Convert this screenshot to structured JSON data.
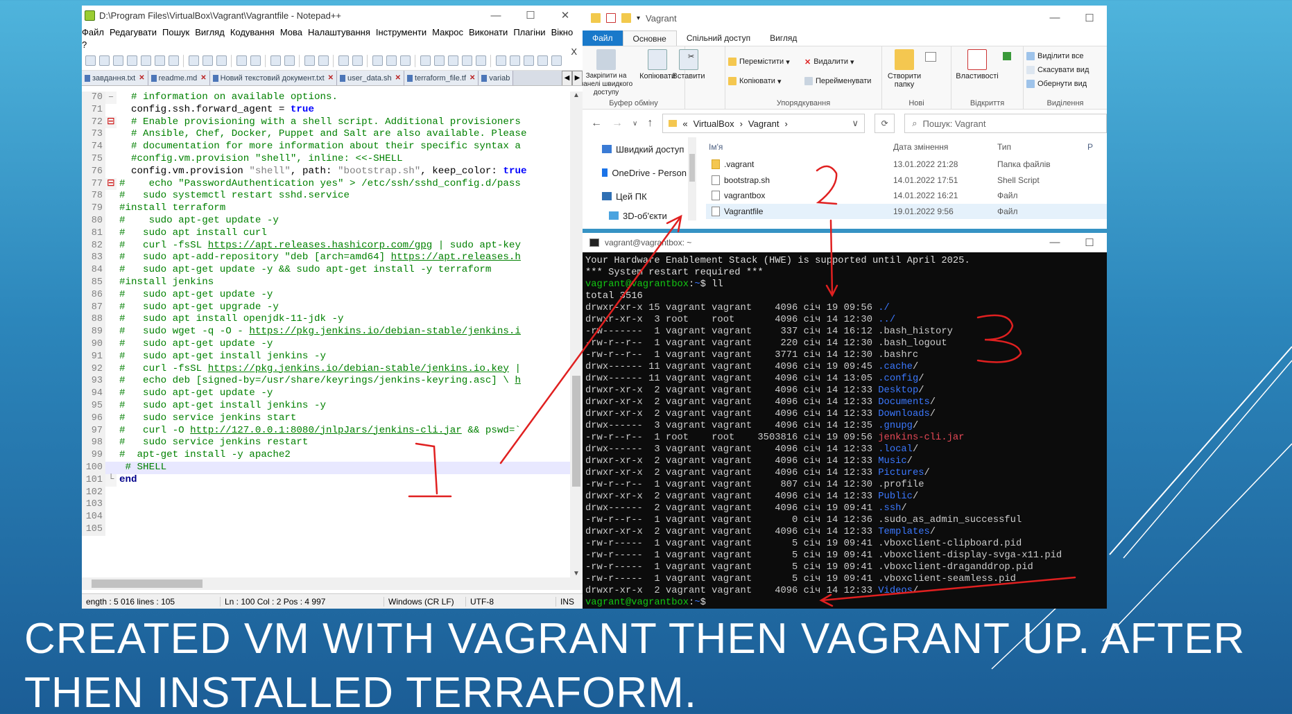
{
  "slide": {
    "title": "Created VM with Vagrant then vagrant up. After\nthen  installed terraform."
  },
  "annotations": {
    "mark1": "1",
    "mark2": "2",
    "mark3": "3",
    "color": "#e02020"
  },
  "notepad": {
    "title": "D:\\Program Files\\VirtualBox\\Vagrant\\Vagrantfile - Notepad++",
    "menu": [
      "Файл",
      "Редагувати",
      "Пошук",
      "Вигляд",
      "Кодування",
      "Мова",
      "Налаштування",
      "Інструменти",
      "Макрос",
      "Виконати",
      "Плагіни",
      "Вікно",
      "?"
    ],
    "menu_close": "X",
    "tabs": [
      "завдання.txt",
      "readme.md",
      "Новий текстовий документ.txt",
      "user_data.sh",
      "terraform_file.tf",
      "variab"
    ],
    "lines": [
      {
        "n": "70",
        "fold": "–",
        "parts": [
          {
            "t": "  # information on available options.",
            "c": "c-com"
          }
        ]
      },
      {
        "n": "71",
        "fold": "",
        "parts": [
          {
            "t": "  config.ssh.forward_agent = ",
            "c": "c-blk"
          },
          {
            "t": "true",
            "c": "c-kw"
          }
        ]
      },
      {
        "n": "72",
        "fold": "⊟",
        "parts": [
          {
            "t": "  # Enable provisioning with a shell script. Additional provisioners",
            "c": "c-com"
          }
        ]
      },
      {
        "n": "73",
        "fold": "",
        "parts": [
          {
            "t": "  # Ansible, Chef, Docker, Puppet and Salt are also available. Please",
            "c": "c-com"
          }
        ]
      },
      {
        "n": "74",
        "fold": "",
        "parts": [
          {
            "t": "  # documentation for more information about their specific syntax a",
            "c": "c-com"
          }
        ]
      },
      {
        "n": "75",
        "fold": "",
        "parts": [
          {
            "t": "  #config.vm.provision \"shell\", inline: <<-SHELL",
            "c": "c-com"
          }
        ]
      },
      {
        "n": "76",
        "fold": "",
        "parts": [
          {
            "t": "  config.vm.provision ",
            "c": "c-blk"
          },
          {
            "t": "\"shell\"",
            "c": "c-str"
          },
          {
            "t": ", path: ",
            "c": "c-blk"
          },
          {
            "t": "\"bootstrap.sh\"",
            "c": "c-str"
          },
          {
            "t": ", keep_color: ",
            "c": "c-blk"
          },
          {
            "t": "true",
            "c": "c-kw"
          }
        ]
      },
      {
        "n": "77",
        "fold": "⊟",
        "parts": [
          {
            "t": "#    echo \"PasswordAuthentication yes\" > /etc/ssh/sshd_config.d/pass",
            "c": "c-com"
          }
        ]
      },
      {
        "n": "78",
        "fold": "",
        "parts": [
          {
            "t": "#   sudo systemctl restart sshd.service",
            "c": "c-com"
          }
        ]
      },
      {
        "n": "79",
        "fold": "",
        "parts": [
          {
            "t": "#install terraform",
            "c": "c-com"
          }
        ]
      },
      {
        "n": "80",
        "fold": "",
        "parts": [
          {
            "t": "#    sudo apt-get update -y",
            "c": "c-com"
          }
        ]
      },
      {
        "n": "81",
        "fold": "",
        "parts": [
          {
            "t": "#   sudo apt install curl",
            "c": "c-com"
          }
        ]
      },
      {
        "n": "82",
        "fold": "",
        "parts": [
          {
            "t": "#   curl -fsSL ",
            "c": "c-com"
          },
          {
            "t": "https://apt.releases.hashicorp.com/gpg",
            "c": "c-url"
          },
          {
            "t": " | sudo apt-key",
            "c": "c-com"
          }
        ]
      },
      {
        "n": "83",
        "fold": "",
        "parts": [
          {
            "t": "#   sudo apt-add-repository \"deb [arch=amd64] ",
            "c": "c-com"
          },
          {
            "t": "https://apt.releases.h",
            "c": "c-url"
          }
        ]
      },
      {
        "n": "84",
        "fold": "",
        "parts": [
          {
            "t": "#   sudo apt-get update -y && sudo apt-get install -y terraform",
            "c": "c-com"
          }
        ]
      },
      {
        "n": "85",
        "fold": "",
        "parts": [
          {
            "t": "#install jenkins",
            "c": "c-com"
          }
        ]
      },
      {
        "n": "86",
        "fold": "",
        "parts": [
          {
            "t": "#   sudo apt-get update -y",
            "c": "c-com"
          }
        ]
      },
      {
        "n": "87",
        "fold": "",
        "parts": [
          {
            "t": "#   sudo apt-get upgrade -y",
            "c": "c-com"
          }
        ]
      },
      {
        "n": "88",
        "fold": "",
        "parts": [
          {
            "t": "#   sudo apt install openjdk-11-jdk -y",
            "c": "c-com"
          }
        ]
      },
      {
        "n": "89",
        "fold": "",
        "parts": [
          {
            "t": "#   sudo wget -q -O - ",
            "c": "c-com"
          },
          {
            "t": "https://pkg.jenkins.io/debian-stable/jenkins.i",
            "c": "c-url"
          }
        ]
      },
      {
        "n": "90",
        "fold": "",
        "parts": [
          {
            "t": "#   sudo apt-get update -y",
            "c": "c-com"
          }
        ]
      },
      {
        "n": "91",
        "fold": "",
        "parts": [
          {
            "t": "#   sudo apt-get install jenkins -y",
            "c": "c-com"
          }
        ]
      },
      {
        "n": "92",
        "fold": "",
        "parts": [
          {
            "t": "#   curl -fsSL ",
            "c": "c-com"
          },
          {
            "t": "https://pkg.jenkins.io/debian-stable/jenkins.io.key",
            "c": "c-url"
          },
          {
            "t": " |",
            "c": "c-com"
          }
        ]
      },
      {
        "n": "93",
        "fold": "",
        "parts": [
          {
            "t": "#   echo deb [signed-by=/usr/share/keyrings/jenkins-keyring.asc] \\ ",
            "c": "c-com"
          },
          {
            "t": "h",
            "c": "c-url"
          }
        ]
      },
      {
        "n": "94",
        "fold": "",
        "parts": [
          {
            "t": "#   sudo apt-get update -y",
            "c": "c-com"
          }
        ]
      },
      {
        "n": "95",
        "fold": "",
        "parts": [
          {
            "t": "#   sudo apt-get install jenkins -y",
            "c": "c-com"
          }
        ]
      },
      {
        "n": "96",
        "fold": "",
        "parts": [
          {
            "t": "#   sudo service jenkins start",
            "c": "c-com"
          }
        ]
      },
      {
        "n": "97",
        "fold": "",
        "parts": [
          {
            "t": "#   curl -O ",
            "c": "c-com"
          },
          {
            "t": "http://127.0.0.1:8080/jnlpJars/jenkins-cli.jar",
            "c": "c-url"
          },
          {
            "t": " && pswd=`",
            "c": "c-com"
          }
        ]
      },
      {
        "n": "98",
        "fold": "",
        "parts": [
          {
            "t": "#   sudo service jenkins restart",
            "c": "c-com"
          }
        ]
      },
      {
        "n": "99",
        "fold": "",
        "parts": [
          {
            "t": "#  apt-get install -y apache2",
            "c": "c-com"
          }
        ]
      },
      {
        "n": "100",
        "fold": "",
        "hl": true,
        "parts": [
          {
            "t": " # SHELL",
            "c": "c-com"
          }
        ]
      },
      {
        "n": "101",
        "fold": "└",
        "parts": [
          {
            "t": "end",
            "c": "c-bk"
          }
        ]
      },
      {
        "n": "102",
        "fold": "",
        "parts": []
      },
      {
        "n": "103",
        "fold": "",
        "parts": []
      },
      {
        "n": "104",
        "fold": "",
        "parts": []
      },
      {
        "n": "105",
        "fold": "",
        "parts": []
      }
    ],
    "status": {
      "length": "ength : 5 016    lines : 105",
      "position": "Ln : 100    Col : 2    Pos : 4 997",
      "eol": "Windows (CR LF)",
      "encoding": "UTF-8",
      "mode": "INS"
    }
  },
  "explorer": {
    "title": "Vagrant",
    "ribbon_tabs": [
      "Файл",
      "Основне",
      "Спільний доступ",
      "Вигляд"
    ],
    "ribbon": {
      "pin": "Закріпити на панелі швидкого доступу",
      "copy": "Копіювати",
      "paste": "Вставити",
      "clipboard": "Буфер обміну",
      "move": "Перемістити",
      "copy_to": "Копіювати",
      "delete": "Видалити",
      "rename": "Перейменувати",
      "organize": "Упорядкування",
      "new_folder": "Створити папку",
      "new": "Нові",
      "properties": "Властивості",
      "open": "Відкриття",
      "select_all": "Виділити все",
      "select_none": "Скасувати вид",
      "invert": "Обернути вид",
      "select": "Виділення"
    },
    "address": [
      "«",
      "VirtualBox",
      "›",
      "Vagrant",
      "›"
    ],
    "search_placeholder": "Пошук: Vagrant",
    "nav": [
      "Швидкий доступ",
      "OneDrive - Person",
      "Цей ПК",
      "3D-об'єкти"
    ],
    "columns": [
      "Ім'я",
      "Дата змінення",
      "Тип",
      "Р"
    ],
    "files": [
      {
        "name": ".vagrant",
        "date": "13.01.2022 21:28",
        "type": "Папка файлів",
        "kind": "folder"
      },
      {
        "name": "bootstrap.sh",
        "date": "14.01.2022 17:51",
        "type": "Shell Script",
        "kind": "file"
      },
      {
        "name": "vagrantbox",
        "date": "14.01.2022 16:21",
        "type": "Файл",
        "kind": "file"
      },
      {
        "name": "Vagrantfile",
        "date": "19.01.2022 9:56",
        "type": "Файл",
        "kind": "file",
        "selected": true
      }
    ]
  },
  "terminal": {
    "title": "vagrant@vagrantbox: ~",
    "lines": [
      [
        {
          "t": "Your Hardware Enablement Stack (HWE) is supported until April 2025.",
          "c": "t-white"
        }
      ],
      [
        {
          "t": "*** System restart required ***",
          "c": "t-white"
        }
      ],
      [
        {
          "t": "vagrant@vagrantbox",
          "c": "t-green"
        },
        {
          "t": ":",
          "c": "t-white"
        },
        {
          "t": "~",
          "c": "t-blue"
        },
        {
          "t": "$ ll",
          "c": "t-white"
        }
      ],
      [
        {
          "t": "total 3516",
          "c": "t-white"
        }
      ],
      [
        {
          "t": "drwxr-xr-x 15 vagrant vagrant    4096 січ 19 09:56 ",
          "c": ""
        },
        {
          "t": "./",
          "c": "t-blue"
        }
      ],
      [
        {
          "t": "drwxr-xr-x  3 root    root       4096 січ 14 12:30 ",
          "c": ""
        },
        {
          "t": "../",
          "c": "t-blue"
        }
      ],
      [
        {
          "t": "-rw-------  1 vagrant vagrant     337 січ 14 16:12 .bash_history",
          "c": ""
        }
      ],
      [
        {
          "t": "-rw-r--r--  1 vagrant vagrant     220 січ 14 12:30 .bash_logout",
          "c": ""
        }
      ],
      [
        {
          "t": "-rw-r--r--  1 vagrant vagrant    3771 січ 14 12:30 .bashrc",
          "c": ""
        }
      ],
      [
        {
          "t": "drwx------ 11 vagrant vagrant    4096 січ 19 09:45 ",
          "c": ""
        },
        {
          "t": ".cache",
          "c": "t-blue"
        },
        {
          "t": "/",
          "c": ""
        }
      ],
      [
        {
          "t": "drwx------ 11 vagrant vagrant    4096 січ 14 13:05 ",
          "c": ""
        },
        {
          "t": ".config",
          "c": "t-blue"
        },
        {
          "t": "/",
          "c": ""
        }
      ],
      [
        {
          "t": "drwxr-xr-x  2 vagrant vagrant    4096 січ 14 12:33 ",
          "c": ""
        },
        {
          "t": "Desktop",
          "c": "t-blue"
        },
        {
          "t": "/",
          "c": ""
        }
      ],
      [
        {
          "t": "drwxr-xr-x  2 vagrant vagrant    4096 січ 14 12:33 ",
          "c": ""
        },
        {
          "t": "Documents",
          "c": "t-blue"
        },
        {
          "t": "/",
          "c": ""
        }
      ],
      [
        {
          "t": "drwxr-xr-x  2 vagrant vagrant    4096 січ 14 12:33 ",
          "c": ""
        },
        {
          "t": "Downloads",
          "c": "t-blue"
        },
        {
          "t": "/",
          "c": ""
        }
      ],
      [
        {
          "t": "drwx------  3 vagrant vagrant    4096 січ 14 12:35 ",
          "c": ""
        },
        {
          "t": ".gnupg",
          "c": "t-blue"
        },
        {
          "t": "/",
          "c": ""
        }
      ],
      [
        {
          "t": "-rw-r--r--  1 root    root    3503816 січ 19 09:56 ",
          "c": ""
        },
        {
          "t": "jenkins-cli.jar",
          "c": "t-red"
        }
      ],
      [
        {
          "t": "drwx------  3 vagrant vagrant    4096 січ 14 12:33 ",
          "c": ""
        },
        {
          "t": ".local",
          "c": "t-blue"
        },
        {
          "t": "/",
          "c": ""
        }
      ],
      [
        {
          "t": "drwxr-xr-x  2 vagrant vagrant    4096 січ 14 12:33 ",
          "c": ""
        },
        {
          "t": "Music",
          "c": "t-blue"
        },
        {
          "t": "/",
          "c": ""
        }
      ],
      [
        {
          "t": "drwxr-xr-x  2 vagrant vagrant    4096 січ 14 12:33 ",
          "c": ""
        },
        {
          "t": "Pictures",
          "c": "t-blue"
        },
        {
          "t": "/",
          "c": ""
        }
      ],
      [
        {
          "t": "-rw-r--r--  1 vagrant vagrant     807 січ 14 12:30 .profile",
          "c": ""
        }
      ],
      [
        {
          "t": "drwxr-xr-x  2 vagrant vagrant    4096 січ 14 12:33 ",
          "c": ""
        },
        {
          "t": "Public",
          "c": "t-blue"
        },
        {
          "t": "/",
          "c": ""
        }
      ],
      [
        {
          "t": "drwx------  2 vagrant vagrant    4096 січ 19 09:41 ",
          "c": ""
        },
        {
          "t": ".ssh",
          "c": "t-blue"
        },
        {
          "t": "/",
          "c": ""
        }
      ],
      [
        {
          "t": "-rw-r--r--  1 vagrant vagrant       0 січ 14 12:36 .sudo_as_admin_successful",
          "c": ""
        }
      ],
      [
        {
          "t": "drwxr-xr-x  2 vagrant vagrant    4096 січ 14 12:33 ",
          "c": ""
        },
        {
          "t": "Templates",
          "c": "t-blue"
        },
        {
          "t": "/",
          "c": ""
        }
      ],
      [
        {
          "t": "-rw-r-----  1 vagrant vagrant       5 січ 19 09:41 .vboxclient-clipboard.pid",
          "c": ""
        }
      ],
      [
        {
          "t": "-rw-r-----  1 vagrant vagrant       5 січ 19 09:41 .vboxclient-display-svga-x11.pid",
          "c": ""
        }
      ],
      [
        {
          "t": "-rw-r-----  1 vagrant vagrant       5 січ 19 09:41 .vboxclient-draganddrop.pid",
          "c": ""
        }
      ],
      [
        {
          "t": "-rw-r-----  1 vagrant vagrant       5 січ 19 09:41 .vboxclient-seamless.pid",
          "c": ""
        }
      ],
      [
        {
          "t": "drwxr-xr-x  2 vagrant vagrant    4096 січ 14 12:33 ",
          "c": ""
        },
        {
          "t": "Videos",
          "c": "t-blue"
        },
        {
          "t": "/",
          "c": ""
        }
      ],
      [
        {
          "t": "vagrant@vagrantbox",
          "c": "t-green"
        },
        {
          "t": ":",
          "c": "t-white"
        },
        {
          "t": "~",
          "c": "t-blue"
        },
        {
          "t": "$ ",
          "c": "t-white"
        }
      ]
    ]
  }
}
